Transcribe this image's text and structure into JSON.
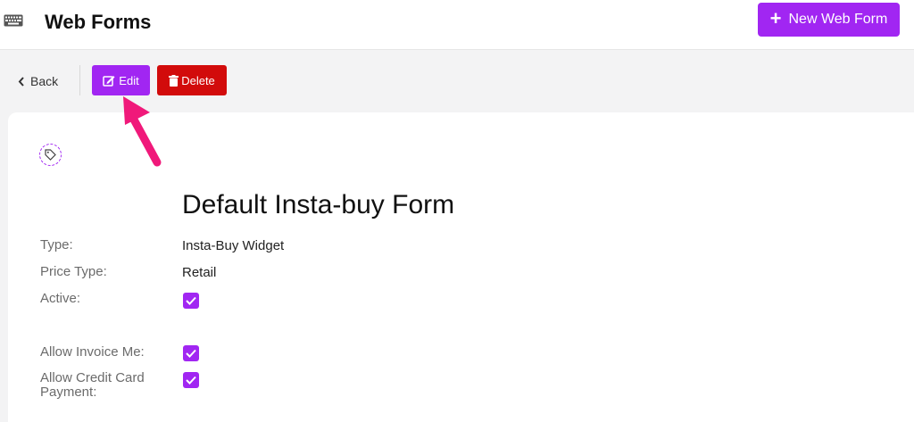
{
  "header": {
    "title": "Web Forms",
    "new_button_label": "New Web Form",
    "keyboard_icon": "keyboard-icon",
    "plus_icon": "plus-icon"
  },
  "toolbar": {
    "back_label": "Back",
    "edit_label": "Edit",
    "delete_label": "Delete",
    "icons": [
      "chevron-left-icon",
      "edit-icon",
      "trash-icon"
    ]
  },
  "form": {
    "title": "Default Insta-buy Form",
    "tag_icon": "tag-icon",
    "fields": {
      "type_label": "Type:",
      "type_value": "Insta-Buy Widget",
      "price_type_label": "Price Type:",
      "price_type_value": "Retail",
      "active_label": "Active:",
      "active_checked": true,
      "allow_invoice_label": "Allow Invoice Me:",
      "allow_invoice_checked": true,
      "allow_cc_label_line1": "Allow Credit Card",
      "allow_cc_label_line2": "Payment:",
      "allow_cc_checked": true
    }
  },
  "colors": {
    "accent": "#a126f2",
    "danger": "#d20b0b",
    "annotation_arrow": "#f0197a"
  }
}
